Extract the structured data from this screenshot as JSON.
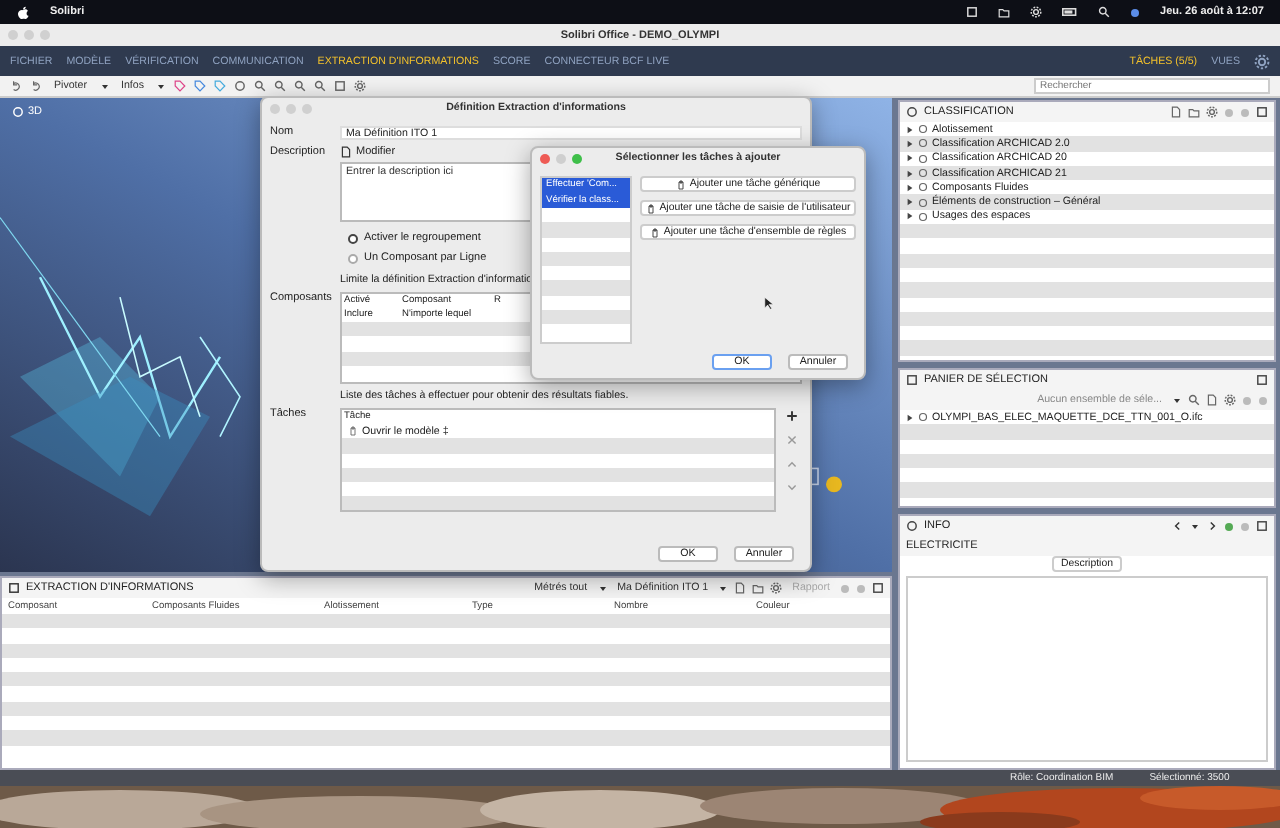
{
  "menubar": {
    "app": "Solibri",
    "clock": "Jeu. 26 août à 12:07"
  },
  "window": {
    "title": "Solibri Office - DEMO_OLYMPI"
  },
  "nav_tabs": [
    {
      "label": "FICHIER",
      "selected": false
    },
    {
      "label": "MODÈLE",
      "selected": false
    },
    {
      "label": "VÉRIFICATION",
      "selected": false
    },
    {
      "label": "COMMUNICATION",
      "selected": false
    },
    {
      "label": "EXTRACTION D'INFORMATIONS",
      "selected": true
    },
    {
      "label": "SCORE",
      "selected": false
    },
    {
      "label": "CONNECTEUR BCF LIVE",
      "selected": false
    }
  ],
  "nav_right": {
    "tasks": "TÂCHES (5/5)",
    "views": "VUES"
  },
  "toolbar": {
    "rotate": "Pivoter",
    "info": "Infos",
    "search": {
      "placeholder": "Rechercher"
    }
  },
  "view3d": {
    "label": "3D"
  },
  "definition_dialog": {
    "title": "Définition Extraction d'informations",
    "name_label": "Nom",
    "name_value": "Ma Définition ITO 1",
    "description_label": "Description",
    "edit_button": "Modifier",
    "description_placeholder": "Entrer la description ici",
    "grouping": [
      {
        "label": "Activer le regroupement",
        "selected": true
      },
      {
        "label": "Un Composant par Ligne",
        "selected": false
      }
    ],
    "components_note": "Limite la définition Extraction d'informatio",
    "components_label": "Composants",
    "components_columns": [
      "Activé",
      "Composant",
      "R"
    ],
    "components_rows": [
      [
        "Inclure",
        "N'importe lequel"
      ]
    ],
    "tasks_note": "Liste des tâches à effectuer pour obtenir des résultats fiables.",
    "tasks_label": "Tâches",
    "tasks_column": "Tâche",
    "tasks_rows": [
      "Ouvrir le modèle ‡"
    ],
    "ok": "OK",
    "cancel": "Annuler"
  },
  "tasks_dialog": {
    "title": "Sélectionner les tâches à ajouter",
    "items": [
      {
        "label": "Effectuer 'Com...",
        "selected": true
      },
      {
        "label": "Vérifier la class...",
        "selected": true
      }
    ],
    "actions": [
      "Ajouter une tâche générique",
      "Ajouter une tâche de saisie de l'utilisateur",
      "Ajouter une tâche d'ensemble de règles"
    ],
    "ok": "OK",
    "cancel": "Annuler"
  },
  "classification": {
    "title": "CLASSIFICATION",
    "items": [
      {
        "label": "Alotissement",
        "expanded": false
      },
      {
        "label": "Classification ARCHICAD 2.0",
        "expanded": false
      },
      {
        "label": "Classification ARCHICAD 20",
        "expanded": false
      },
      {
        "label": "Classification ARCHICAD 21",
        "expanded": false
      },
      {
        "label": "Composants Fluides",
        "expanded": false
      },
      {
        "label": "Éléments de construction – Général",
        "expanded": false
      },
      {
        "label": "Usages des espaces",
        "expanded": false
      }
    ]
  },
  "selection_basket": {
    "title": "PANIER DE SÉLECTION",
    "set_dropdown": "Aucun ensemble de séle...",
    "items": [
      {
        "label": "OLYMPI_BAS_ELEC_MAQUETTE_DCE_TTN_001_O.ifc",
        "expanded": false
      }
    ]
  },
  "info": {
    "title": "INFO",
    "heading": "ELECTRICITE",
    "tab": "Description"
  },
  "extraction": {
    "title": "EXTRACTION D'INFORMATIONS",
    "quantities": "Métrés tout",
    "definition": "Ma Définition ITO 1",
    "report": "Rapport",
    "report_disabled": true,
    "columns": [
      "Composant",
      "Composants Fluides",
      "Alotissement",
      "Type",
      "Nombre",
      "Couleur"
    ]
  },
  "status_bar": {
    "role": "Rôle: Coordination BIM",
    "selected": "Sélectionné: 3500"
  }
}
